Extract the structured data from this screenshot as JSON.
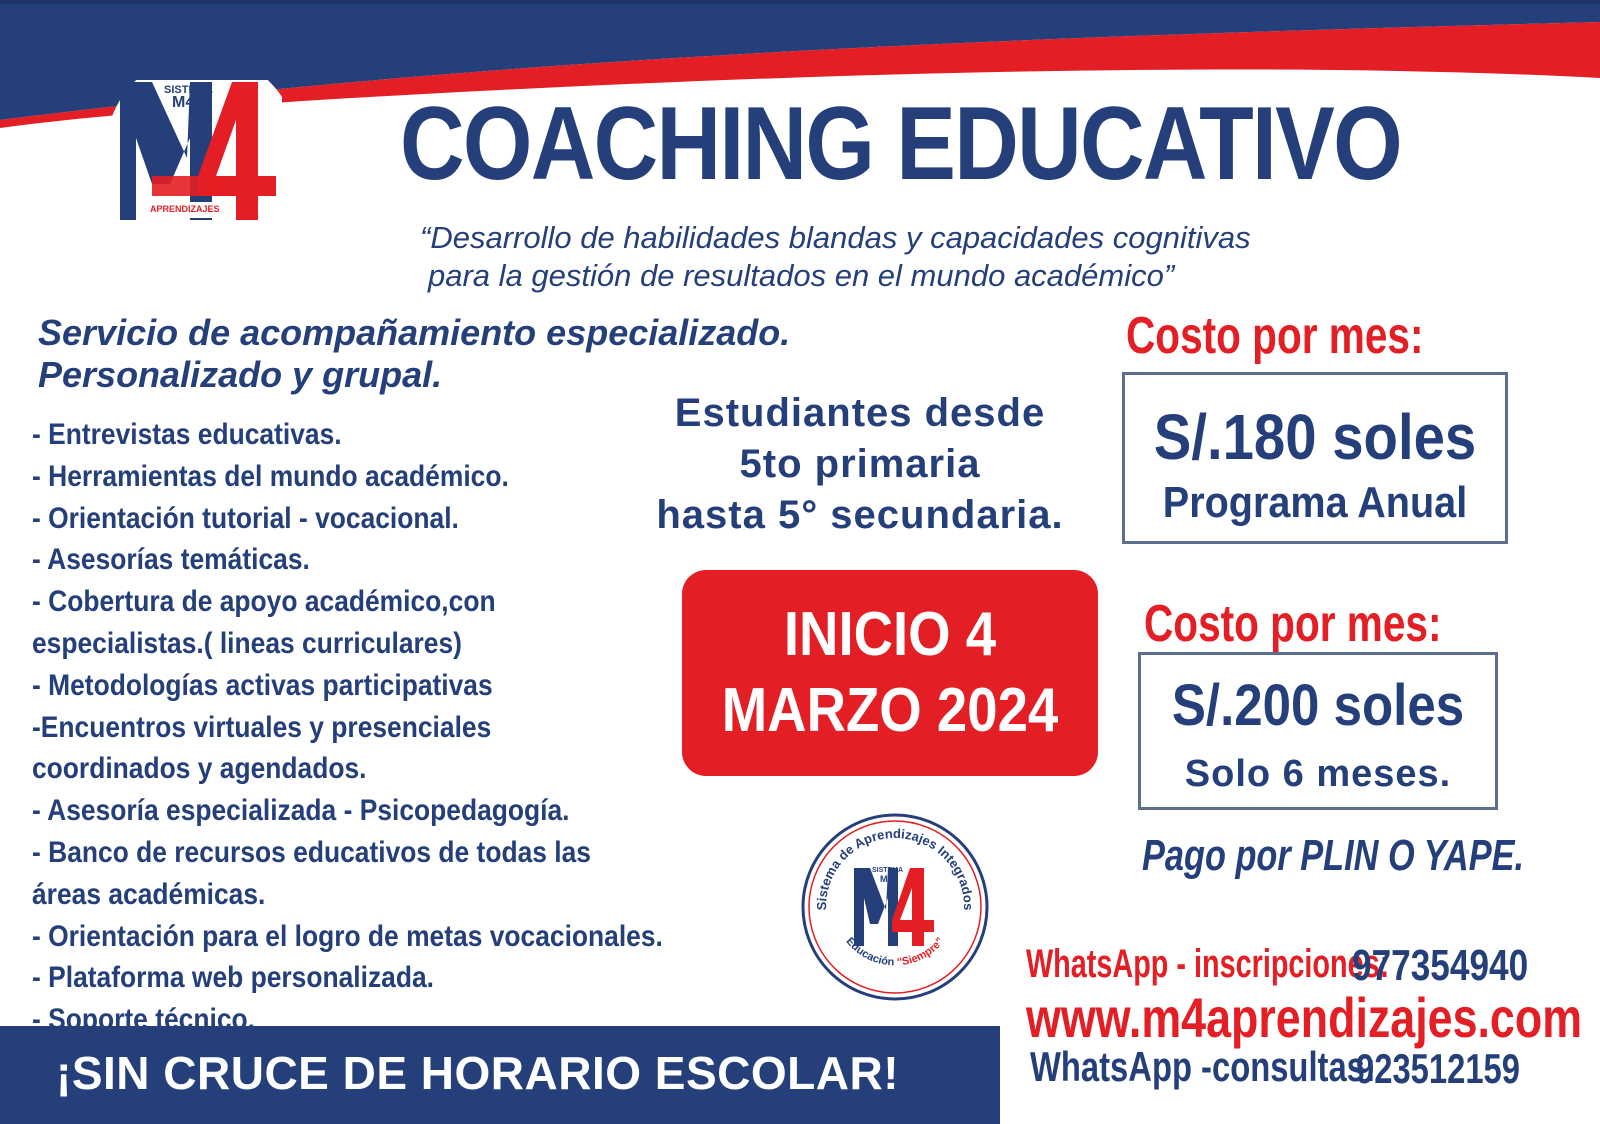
{
  "colors": {
    "navy": "#243f7a",
    "red": "#e31e24",
    "white": "#ffffff"
  },
  "logo": {
    "sistema": "SISTEMA",
    "m4_small": "M4",
    "big": "M4",
    "aprendizajes": "APRENDIZAJES"
  },
  "title": "COACHING EDUCATIVO",
  "subtitle": {
    "line1": "“Desarrollo de habilidades blandas y capacidades cognitivas",
    "line2": "para la gestión de resultados en el mundo académico”"
  },
  "service": {
    "line1": "Servicio de acompañamiento especializado.",
    "line2": "Personalizado y grupal."
  },
  "features": [
    "- Entrevistas educativas.",
    "- Herramientas del mundo académico.",
    "- Orientación tutorial - vocacional.",
    "- Asesorías temáticas.",
    "- Cobertura de apoyo académico,con",
    "   especialistas.( lineas curriculares)",
    "- Metodologías activas participativas",
    "-Encuentros virtuales y presenciales",
    "coordinados y agendados.",
    "- Asesoría especializada - Psicopedagogía.",
    "- Banco de recursos educativos de todas las",
    "   áreas académicas.",
    "- Orientación para el logro de metas vocacionales.",
    "- Plataforma web personalizada.",
    "- Soporte técnico."
  ],
  "students": {
    "line1": "Estudiantes desde",
    "line2": "5to primaria",
    "line3": "hasta 5° secundaria."
  },
  "start": {
    "line1": "INICIO 4",
    "line2": "MARZO 2024"
  },
  "plans": [
    {
      "label": "Costo por mes:",
      "price": "S/.180 soles",
      "detail": "Programa Anual"
    },
    {
      "label": "Costo por mes:",
      "price": "S/.200 soles",
      "detail": "Solo 6 meses."
    }
  ],
  "payment": "Pago por PLIN O YAPE.",
  "seal": {
    "ring_top": "Sistema de Aprendizajes Integrados",
    "ring_bottom_1": "Educación",
    "ring_bottom_2": "“Siempre”",
    "sistema": "SISTEMA",
    "m4_small": "M4",
    "big": "M4"
  },
  "contact": {
    "inscripciones_label": "WhatsApp - inscripciones:",
    "inscripciones_number": "977354940",
    "website": "www.m4aprendizajes.com",
    "consultas_label": "WhatsApp -consultas:",
    "consultas_number": "923512159"
  },
  "banner": "¡SIN CRUCE DE HORARIO ESCOLAR!"
}
